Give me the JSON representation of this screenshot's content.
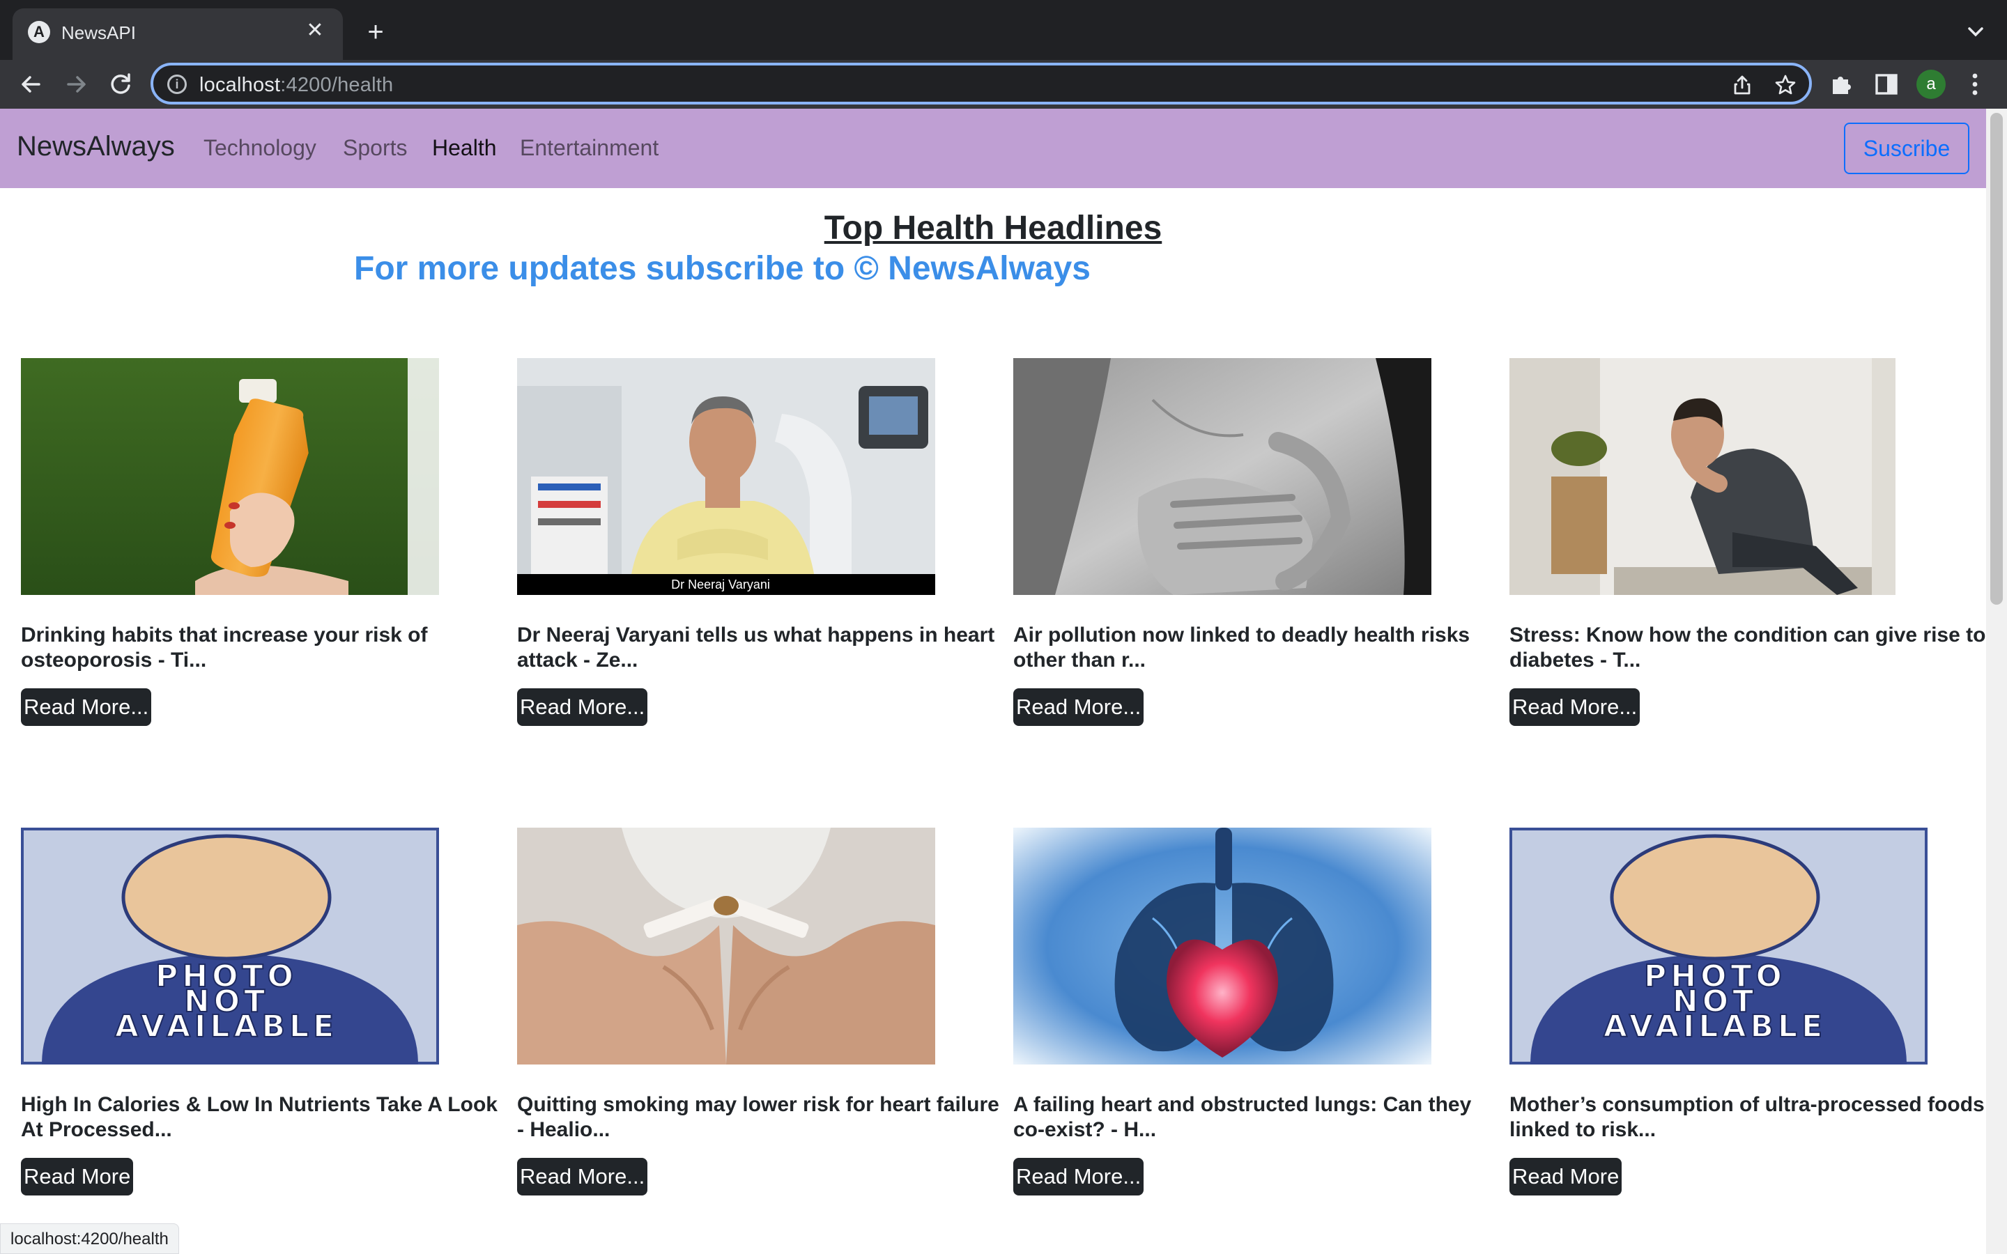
{
  "browser": {
    "tab_title": "NewsAPI",
    "tab_favicon": "A",
    "tab_close": "✕",
    "new_tab": "+",
    "url_host": "localhost",
    "url_path": ":4200/health",
    "profile_initial": "a",
    "status_url": "localhost:4200/health"
  },
  "navbar": {
    "brand": "NewsAlways",
    "links": [
      "Technology",
      "Sports",
      "Health",
      "Entertainment"
    ],
    "active_link": "Health",
    "subscribe_label": "Suscribe"
  },
  "main": {
    "heading": "Top Health Headlines",
    "subheading": "For more updates subscribe to © NewsAlways"
  },
  "articles": [
    {
      "title": "Drinking habits that increase your risk of osteoporosis - Ti...",
      "button": "Read More...",
      "image": "orange-juice-bottle"
    },
    {
      "title": "Dr Neeraj Varyani tells us what happens in heart attack - Ze...",
      "button": "Read More...",
      "image": "doctor-portrait",
      "image_caption": "Dr Neeraj Varyani"
    },
    {
      "title": "Air pollution now linked to deadly health risks other than r...",
      "button": "Read More...",
      "image": "chest-pain-bw"
    },
    {
      "title": "Stress: Know how the condition can give rise to diabetes - T...",
      "button": "Read More...",
      "image": "stressed-man"
    },
    {
      "title": "High In Calories & Low In Nutrients Take A Look At Processed...",
      "button": "Read More",
      "image": "photo-not-available"
    },
    {
      "title": "Quitting smoking may lower risk for heart failure - Healio...",
      "button": "Read More...",
      "image": "broken-cigarette"
    },
    {
      "title": "A failing heart and obstructed lungs: Can they co-exist? - H...",
      "button": "Read More...",
      "image": "heart-lungs-illustration"
    },
    {
      "title": "Mother’s consumption of ultra-processed foods linked to risk...",
      "button": "Read More",
      "image": "photo-not-available"
    }
  ],
  "placeholder_text": [
    "PHOTO",
    "NOT",
    "AVAILABLE"
  ],
  "colors": {
    "navbar_bg": "#bf9fd3",
    "subheading": "#3b8ee8",
    "button_bg": "#212529",
    "subscribe": "#0d6efd"
  }
}
